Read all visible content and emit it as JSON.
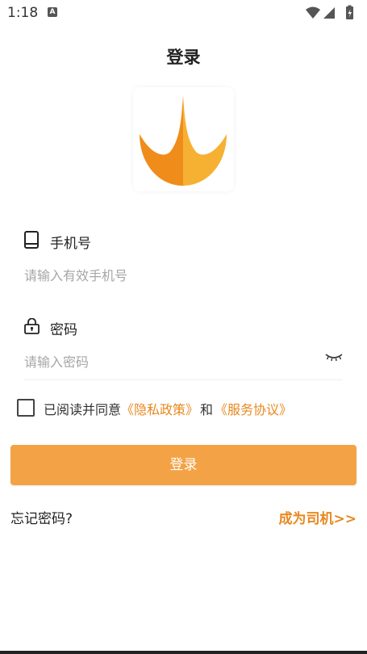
{
  "status_bar": {
    "time": "1:18",
    "sim_badge": "A",
    "icons": [
      "wifi-icon",
      "signal-icon",
      "battery-icon"
    ]
  },
  "page": {
    "title": "登录"
  },
  "logo": {
    "icon": "flame-logo",
    "colors": {
      "left": "#f08c1a",
      "right": "#f6b132"
    }
  },
  "phone": {
    "label": "手机号",
    "icon": "phone-icon",
    "placeholder": "请输入有效手机号"
  },
  "password": {
    "label": "密码",
    "icon": "lock-icon",
    "placeholder": "请输入密码",
    "toggle_icon": "eye-closed-icon"
  },
  "agreement": {
    "checked": false,
    "prefix": "已阅读并同意",
    "privacy_link": "《隐私政策》",
    "conjunction": "和",
    "service_link": "《服务协议》"
  },
  "actions": {
    "login_label": "登录",
    "forgot_label": "忘记密码?",
    "driver_label": "成为司机>>"
  },
  "colors": {
    "accent": "#e8881f",
    "button": "#f3a345"
  }
}
